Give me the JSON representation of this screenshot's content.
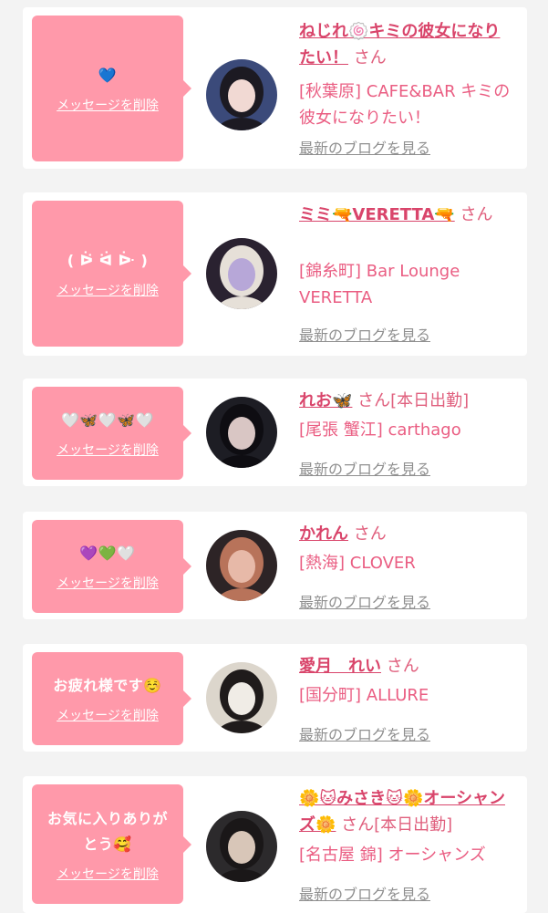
{
  "items": [
    {
      "message": "💙",
      "delete_label": "メッセージを削除",
      "name": "ねじれ🍥キミの彼女になりたい！",
      "san": "さん",
      "shop": "[秋葉原] CAFE&BAR キミの彼女になりたい！",
      "blog_label": "最新のブログを見る",
      "avatar_bg": "#3b4a7a",
      "avatar_fg": "#f1d9d3",
      "avatar_hair": "#1c1a22"
    },
    {
      "message": "( ᐖ ᐛ ᐕ )",
      "delete_label": "メッセージを削除",
      "name": "ミミ🔫VERETTA🔫",
      "san": "さん",
      "shop": "[錦糸町] Bar Lounge VERETTA",
      "blog_label": "最新のブログを見る",
      "avatar_bg": "#2a2230",
      "avatar_fg": "#b7a7d8",
      "avatar_hair": "#e6e0d8"
    },
    {
      "message": "🤍🦋🤍🦋🤍",
      "delete_label": "メッセージを削除",
      "name": "れお🦋",
      "san": "さん[本日出勤]",
      "shop": "[尾張 蟹江] carthago",
      "blog_label": "最新のブログを見る",
      "avatar_bg": "#1d1d24",
      "avatar_fg": "#d9c6c4",
      "avatar_hair": "#0e0d12"
    },
    {
      "message": "💜💚🤍",
      "delete_label": "メッセージを削除",
      "name": "かれん",
      "san": "さん",
      "shop": "[熱海] CLOVER",
      "blog_label": "最新のブログを見る",
      "avatar_bg": "#2d2426",
      "avatar_fg": "#e7b9a8",
      "avatar_hair": "#b8735a"
    },
    {
      "message": "お疲れ様です☺️",
      "delete_label": "メッセージを削除",
      "name": "愛月　れい",
      "san": "さん",
      "shop": "[国分町] ALLURE",
      "blog_label": "最新のブログを見る",
      "avatar_bg": "#dcd6cc",
      "avatar_fg": "#f0ece6",
      "avatar_hair": "#1f1b1b"
    },
    {
      "message": "お気に入りありがとう🥰",
      "delete_label": "メッセージを削除",
      "name": "🌼🐱みさき🐱🌼オーシャンズ🌼",
      "san": "さん[本日出勤]",
      "shop": "[名古屋 錦] オーシャンズ",
      "blog_label": "最新のブログを見る",
      "avatar_bg": "#2c2a2c",
      "avatar_fg": "#d8c6b8",
      "avatar_hair": "#1a1718"
    }
  ]
}
